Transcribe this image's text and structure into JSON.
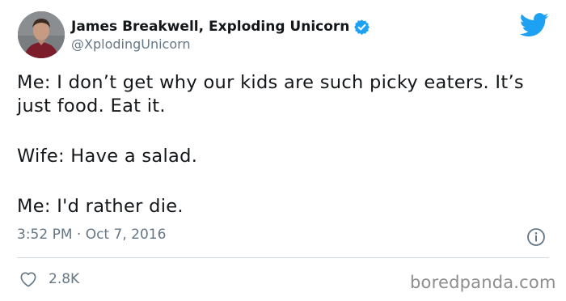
{
  "author": {
    "display_name": "James Breakwell, Exploding Unicorn",
    "handle": "@XplodingUnicorn",
    "verified": true
  },
  "tweet": {
    "lines": [
      "Me: I don’t get why our kids are such picky eaters. It’s just food. Eat it.",
      "Wife: Have a salad.",
      "Me: I'd rather die."
    ],
    "timestamp": "3:52 PM · Oct 7, 2016",
    "like_count": "2.8K"
  },
  "icons": {
    "brand": "twitter-bird-icon",
    "verified": "verified-badge-icon",
    "info": "info-icon",
    "like": "heart-icon"
  },
  "colors": {
    "twitter_blue": "#1da1f2",
    "secondary_text": "#657786",
    "primary_text": "#14171a"
  },
  "watermark": "boredpanda.com"
}
